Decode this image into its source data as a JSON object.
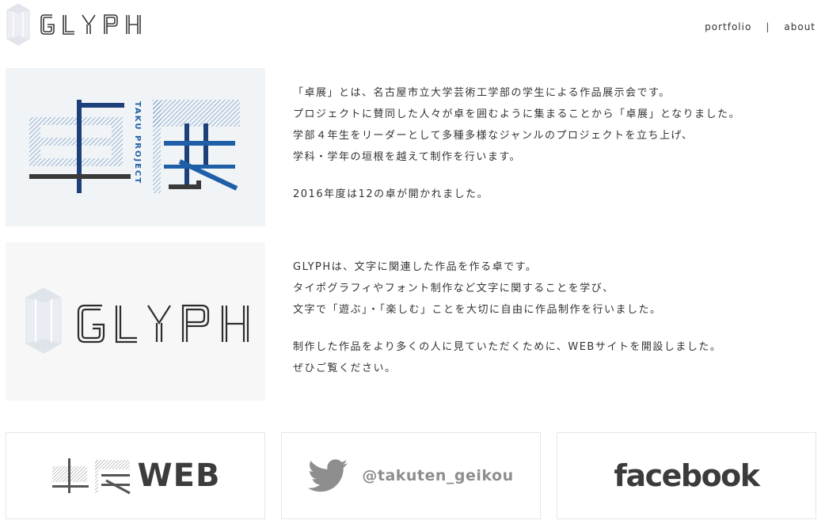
{
  "header": {
    "logo_text": "GLYPH",
    "nav": {
      "portfolio": "portfolio",
      "separator": "|",
      "about": "about"
    }
  },
  "taku": {
    "logo_title": "卓展",
    "logo_vertical": "TAKU PROJECT",
    "paragraphs": [
      "「卓展」とは、名古屋市立大学芸術工学部の学生による作品展示会です。",
      "プロジェクトに賛同した人々が卓を囲むように集まることから「卓展」となりました。",
      "学部４年生をリーダーとして多種多様なジャンルのプロジェクトを立ち上げ、",
      "学科・学年の垣根を越えて制作を行います。"
    ],
    "note": "2016年度は12の卓が開かれました。"
  },
  "glyph": {
    "logo_text": "GLYPH",
    "paragraphs": [
      "GLYPHは、文字に関連した作品を作る卓です。",
      "タイポグラフィやフォント制作など文字に関することを学び、",
      "文字で「遊ぶ」・「楽しむ」ことを大切に自由に作品制作を行いました。"
    ],
    "paragraphs2": [
      "制作した作品をより多くの人に見ていただくために、WEBサイトを開設しました。",
      "ぜひご覧ください。"
    ]
  },
  "links": {
    "web_kanji": "卓展",
    "web_label": "WEB",
    "twitter_handle": "@takuten_geikou",
    "facebook_label": "facebook"
  },
  "colors": {
    "accent_blue": "#1f5fa8",
    "dark_blue": "#1d3f7a",
    "gray": "#8e8e8e"
  }
}
